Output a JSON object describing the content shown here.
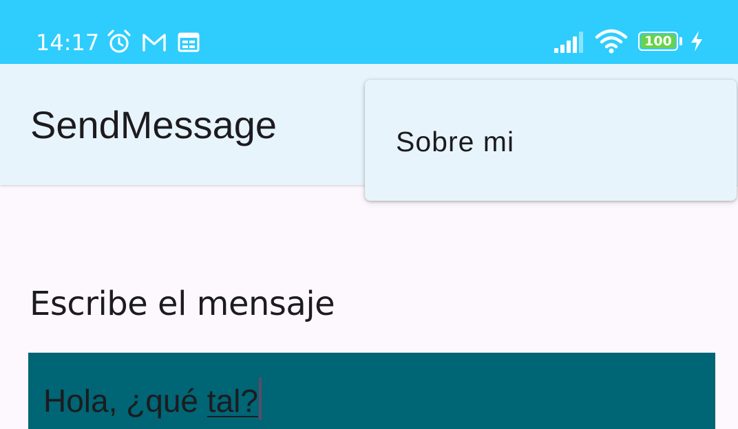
{
  "status_bar": {
    "time": "14:17",
    "battery_level": "100",
    "icons": [
      "alarm-icon",
      "gmail-icon",
      "calendar-icon",
      "signal-icon",
      "wifi-icon",
      "battery-icon",
      "charging-bolt-icon"
    ],
    "colors": {
      "background": "#2ecdfd",
      "battery_fill": "#69d24a"
    }
  },
  "app_bar": {
    "title": "SendMessage",
    "background": "#e8f4fc"
  },
  "overflow_menu": {
    "items": [
      {
        "label": "Sobre mi"
      }
    ]
  },
  "main": {
    "heading": "Escribe el mensaje",
    "message_input": {
      "value_prefix": "Hola, ¿qué ",
      "value_composing": "tal?",
      "background": "#006574"
    }
  }
}
